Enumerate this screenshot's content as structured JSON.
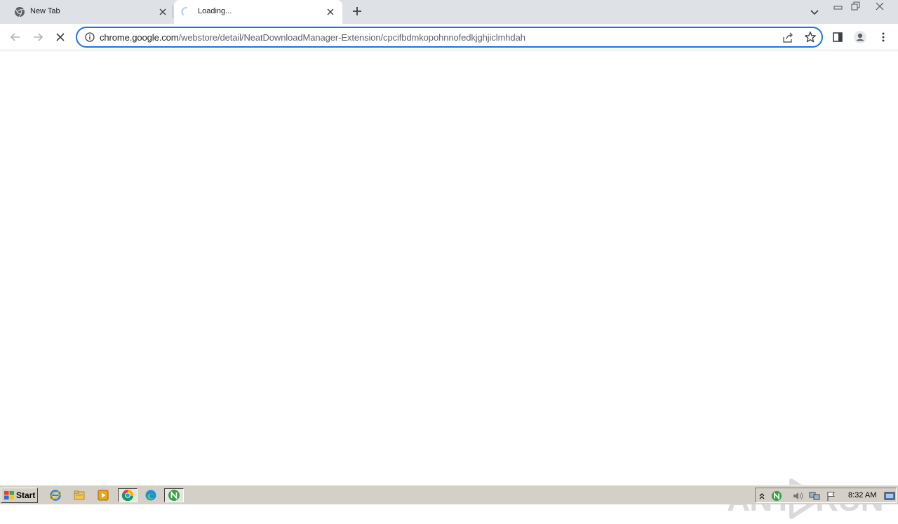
{
  "tabs": [
    {
      "title": "New Tab",
      "favicon": "chrome-icon",
      "active": false
    },
    {
      "title": "Loading...",
      "favicon": "loading-spinner-icon",
      "active": true
    }
  ],
  "toolbar": {
    "url_host": "chrome.google.com",
    "url_path": "/webstore/detail/NeatDownloadManager-Extension/cpcifbdmkopohnnofedkjghjiclmhdah"
  },
  "watermark": {
    "left": "ANY",
    "right": "RUN"
  },
  "taskbar": {
    "start_label": "Start",
    "apps": [
      "internet-explorer-icon",
      "file-explorer-icon",
      "media-player-icon",
      "chrome-icon",
      "edge-icon",
      "neat-download-manager-icon"
    ],
    "clock": "8:32 AM"
  },
  "colors": {
    "accent": "#1a73e8",
    "tabstrip": "#dee1e6",
    "taskbar": "#d4d0c8"
  }
}
